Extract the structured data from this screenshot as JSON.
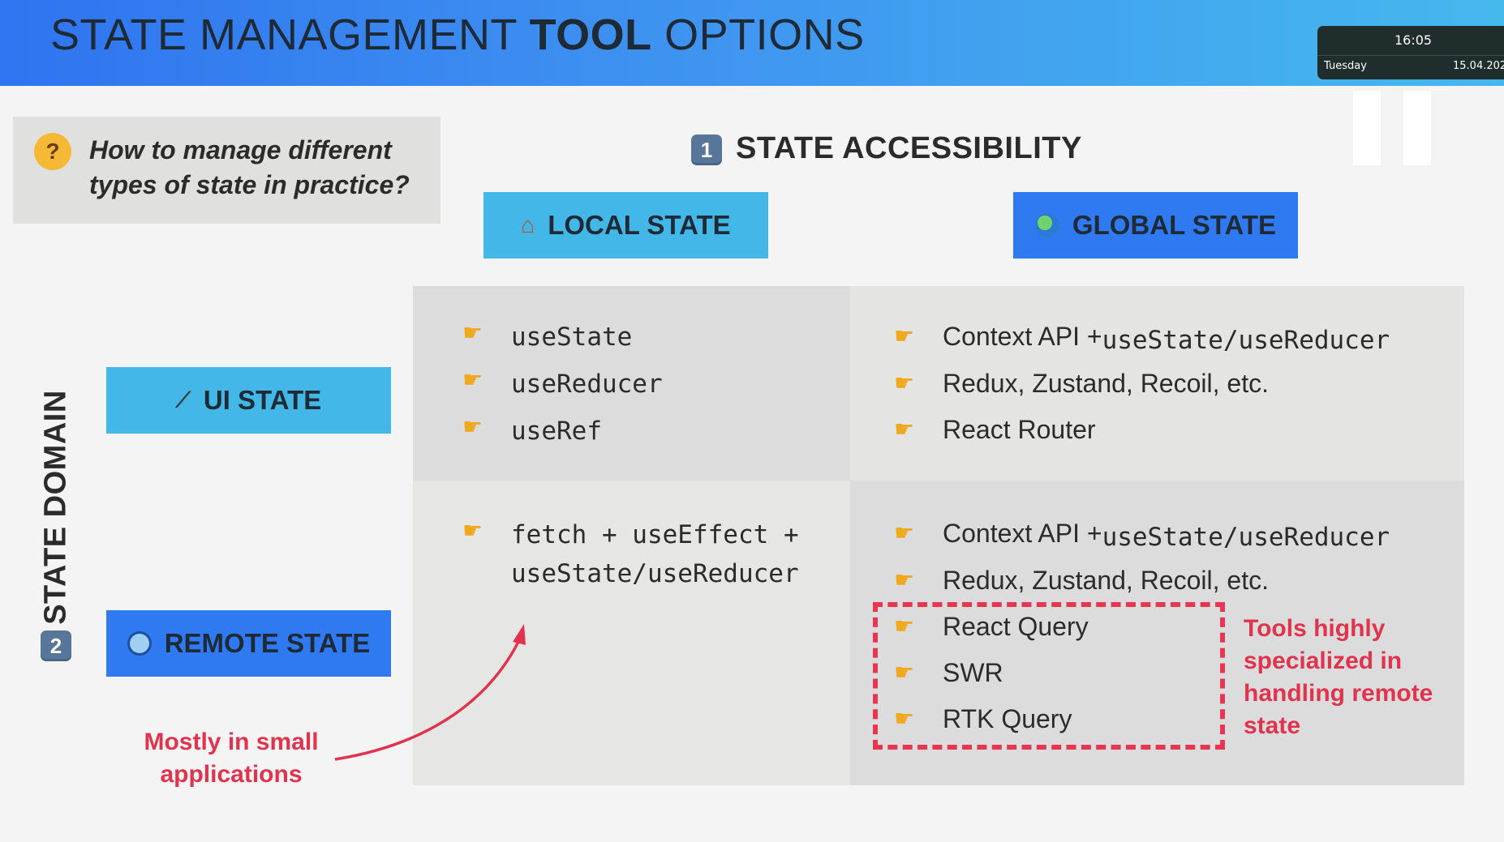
{
  "header": {
    "title_part1": "STATE MANAGEMENT ",
    "title_bold": "TOOL",
    "title_part2": " OPTIONS"
  },
  "clock": {
    "time": "16:05",
    "day": "Tuesday",
    "date": "15.04.202"
  },
  "question": {
    "emoji": "thinking-face-icon",
    "text": "How to manage different types of state in practice?"
  },
  "accessibility": {
    "badge": "1",
    "title": "STATE ACCESSIBILITY",
    "local_label": "LOCAL STATE",
    "global_label": "GLOBAL STATE"
  },
  "domain": {
    "badge": "2",
    "title": "STATE DOMAIN",
    "ui_label": "UI STATE",
    "remote_label": "REMOTE STATE"
  },
  "matrix": {
    "ui_local": [
      "useState",
      "useReducer",
      "useRef"
    ],
    "ui_global": [
      {
        "plain": "Context API + ",
        "code": "useState/useReducer"
      },
      {
        "plain": "Redux, Zustand, Recoil, etc.",
        "code": ""
      },
      {
        "plain": "React Router",
        "code": ""
      }
    ],
    "remote_local": {
      "line1": "fetch + useEffect +",
      "line2": "useState/useReducer"
    },
    "remote_global": [
      {
        "plain": "Context API + ",
        "code": "useState/useReducer"
      },
      {
        "plain": "Redux, Zustand, Recoil, etc.",
        "code": ""
      },
      {
        "plain": "React Query",
        "code": ""
      },
      {
        "plain": "SWR",
        "code": ""
      },
      {
        "plain": "RTK Query",
        "code": ""
      }
    ]
  },
  "notes": {
    "specialized_pre": "Tools highly specialized in handling ",
    "specialized_bold": "remote",
    "specialized_post": " state",
    "small_apps": "Mostly in small applications"
  },
  "colors": {
    "accent_red": "#e0344e",
    "local_blue": "#43b8e8",
    "global_blue": "#2f7af1"
  }
}
